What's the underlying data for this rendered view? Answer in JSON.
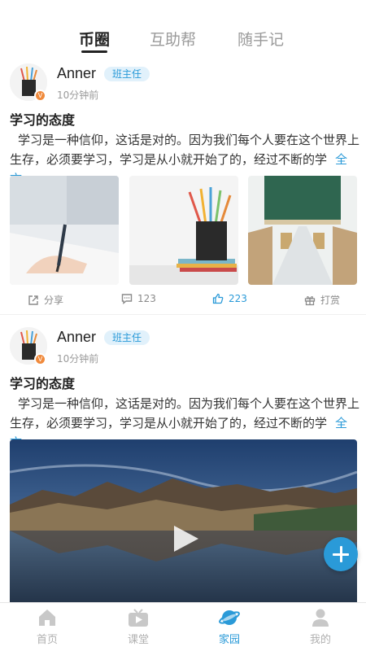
{
  "tabs": [
    {
      "label": "币圈",
      "active": true
    },
    {
      "label": "互助帮",
      "active": false
    },
    {
      "label": "随手记",
      "active": false
    }
  ],
  "posts": [
    {
      "author": "Anner",
      "role": "班主任",
      "time": "10分钟前",
      "title": "学习的态度",
      "body": "学习是一种信仰，这话是对的。因为我们每个人要在这个世界上生存，必须要学习，学习是从小就开始了的，经过不断的学",
      "more": "全文",
      "media": "images",
      "actions": {
        "share": "分享",
        "comments": "123",
        "likes": "223",
        "reward": "打赏"
      }
    },
    {
      "author": "Anner",
      "role": "班主任",
      "time": "10分钟前",
      "title": "学习的态度",
      "body": "学习是一种信仰，这话是对的。因为我们每个人要在这个世界上生存，必须要学习，学习是从小就开始了的，经过不断的学",
      "more": "全文",
      "media": "video"
    }
  ],
  "nav": [
    {
      "label": "首页",
      "icon": "home-icon",
      "active": false
    },
    {
      "label": "课堂",
      "icon": "tv-icon",
      "active": false
    },
    {
      "label": "家园",
      "icon": "planet-icon",
      "active": true
    },
    {
      "label": "我的",
      "icon": "user-icon",
      "active": false
    }
  ],
  "colors": {
    "accent": "#2a9ad8",
    "badge_bg": "#e1f1fb",
    "avatar_badge": "#f08a3c"
  }
}
